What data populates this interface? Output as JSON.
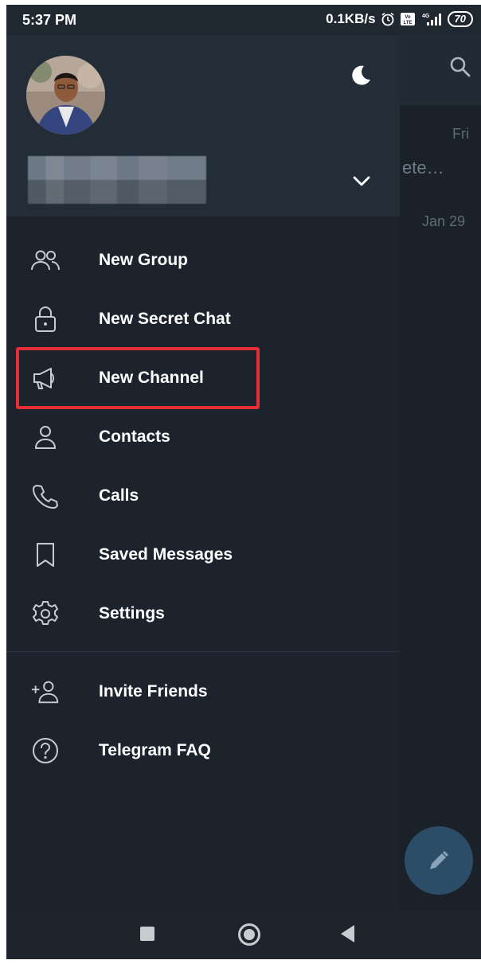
{
  "status_bar": {
    "time": "5:37 PM",
    "net_speed": "0.1KB/s",
    "network_type": "4G",
    "volte": "Vo LTE",
    "battery": "70",
    "icons": [
      "alarm-icon",
      "volte-icon",
      "signal-icon",
      "battery-icon"
    ]
  },
  "background_list": {
    "date_1": "Fri",
    "snippet": "ete…",
    "date_2": "Jan 29"
  },
  "drawer": {
    "theme_icon": "moon-icon",
    "menu": [
      {
        "label": "New Group",
        "icon": "group-icon"
      },
      {
        "label": "New Secret Chat",
        "icon": "lock-icon"
      },
      {
        "label": "New Channel",
        "icon": "megaphone-icon"
      },
      {
        "label": "Contacts",
        "icon": "contact-icon"
      },
      {
        "label": "Calls",
        "icon": "phone-icon"
      },
      {
        "label": "Saved Messages",
        "icon": "bookmark-icon"
      },
      {
        "label": "Settings",
        "icon": "gear-icon"
      }
    ],
    "secondary_menu": [
      {
        "label": "Invite Friends",
        "icon": "add-person-icon"
      },
      {
        "label": "Telegram FAQ",
        "icon": "help-icon"
      }
    ]
  },
  "colors": {
    "drawer_bg": "#1c232c",
    "header_bg": "#232d38",
    "text": "#ffffff",
    "icon": "#c5ccd3",
    "highlight": "#e62e34",
    "fab": "#2b4d68"
  }
}
